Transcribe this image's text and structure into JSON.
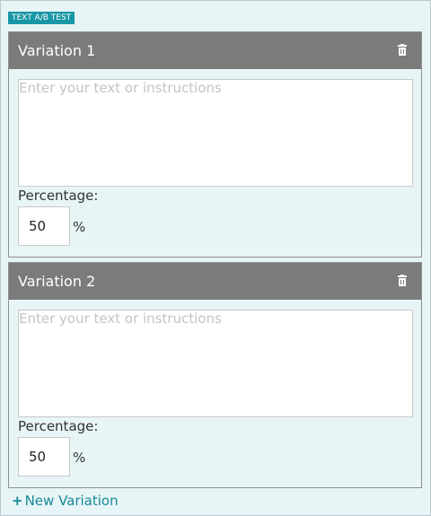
{
  "section": {
    "badge": "TEXT A/B TEST"
  },
  "variations": [
    {
      "title": "Variation 1",
      "text_placeholder": "Enter your text or instructions",
      "text_value": "",
      "percentage_label": "Percentage:",
      "percentage_value": "50",
      "percentage_unit": "%",
      "delete_icon": "trash-icon"
    },
    {
      "title": "Variation 2",
      "text_placeholder": "Enter your text or instructions",
      "text_value": "",
      "percentage_label": "Percentage:",
      "percentage_value": "50",
      "percentage_unit": "%",
      "delete_icon": "trash-icon"
    }
  ],
  "actions": {
    "new_variation_icon": "+",
    "new_variation_label": "New Variation"
  },
  "colors": {
    "panel_bg": "#e8f5f7",
    "badge_bg": "#1897a6",
    "header_bg": "#7b7b7b",
    "link": "#168a96"
  }
}
